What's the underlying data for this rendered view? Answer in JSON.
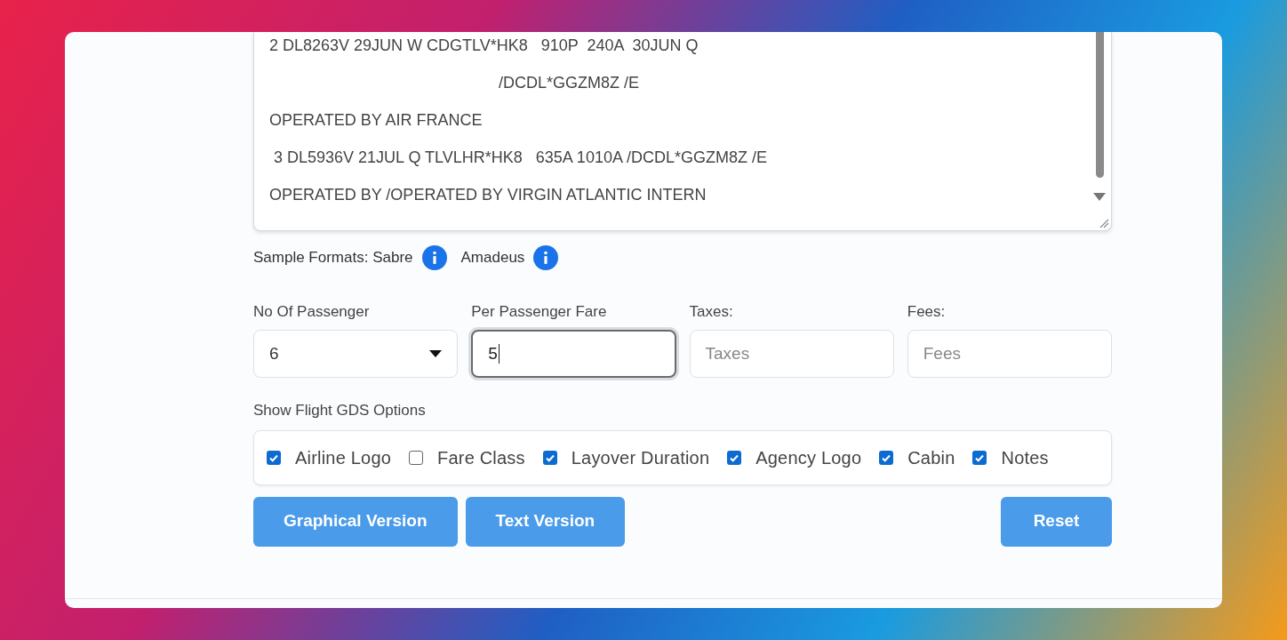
{
  "gds_text": {
    "lines": [
      {
        "text": "2 DL8263V 29JUN W CDGTLV*HK8   910P  240A  30JUN Q",
        "indent": false
      },
      {
        "text": "/DCDL*GGZM8Z /E",
        "indent": true
      },
      {
        "text": "OPERATED BY AIR FRANCE",
        "indent": false
      },
      {
        "text": " 3 DL5936V 21JUL Q TLVLHR*HK8   635A 1010A /DCDL*GGZM8Z /E",
        "indent": false
      },
      {
        "text": "OPERATED BY /OPERATED BY VIRGIN ATLANTIC INTERN",
        "indent": false
      }
    ]
  },
  "sample_formats": {
    "label": "Sample Formats: Sabre",
    "second": "Amadeus"
  },
  "fields": [
    {
      "kind": "select",
      "label": "No Of Passenger",
      "value": "6",
      "focused": false
    },
    {
      "kind": "input",
      "label": "Per Passenger Fare",
      "value": "5",
      "focused": true
    },
    {
      "kind": "input",
      "label": "Taxes:",
      "placeholder": "Taxes",
      "focused": false
    },
    {
      "kind": "input",
      "label": "Fees:",
      "placeholder": "Fees",
      "focused": false
    }
  ],
  "options": {
    "title": "Show Flight GDS Options",
    "items": [
      {
        "label": "Airline Logo",
        "checked": true
      },
      {
        "label": "Fare Class",
        "checked": false
      },
      {
        "label": "Layover Duration",
        "checked": true
      },
      {
        "label": "Agency Logo",
        "checked": true
      },
      {
        "label": "Cabin",
        "checked": true
      },
      {
        "label": "Notes",
        "checked": true
      }
    ]
  },
  "version_buttons": [
    "Graphical Version",
    "Text Version"
  ],
  "reset_button": "Reset"
}
